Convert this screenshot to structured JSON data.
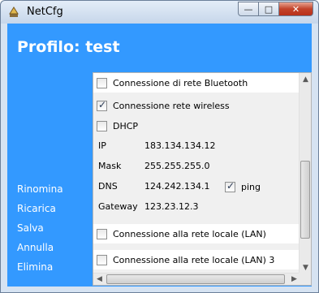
{
  "window": {
    "title": "NetCfg",
    "buttons": {
      "minimize": "—",
      "maximize": "□",
      "close": "✕"
    }
  },
  "profile": {
    "title": "Profilo: test"
  },
  "actions": [
    "Rinomina",
    "Ricarica",
    "Salva",
    "Annulla",
    "Elimina"
  ],
  "connections": {
    "bluetooth": {
      "label": "Connessione di rete Bluetooth",
      "checked": false
    },
    "wireless": {
      "label": "Connessione rete wireless",
      "checked": true,
      "dhcp": {
        "label": "DHCP",
        "checked": false
      },
      "ip": {
        "label": "IP",
        "value": "183.134.134.12"
      },
      "mask": {
        "label": "Mask",
        "value": "255.255.255.0"
      },
      "dns": {
        "label": "DNS",
        "value": "124.242.134.1"
      },
      "ping": {
        "label": "ping",
        "checked": true
      },
      "gateway": {
        "label": "Gateway",
        "value": "123.23.12.3"
      }
    },
    "lan": {
      "label": "Connessione alla rete locale (LAN)",
      "checked": false
    },
    "lan3": {
      "label": "Connessione alla rete locale (LAN) 3",
      "checked": false
    }
  },
  "scrollbars": {
    "arrows": {
      "up": "▲",
      "down": "▼",
      "left": "◀",
      "right": "▶"
    }
  },
  "colors": {
    "accent": "#3399ff",
    "panel_bg": "#f0f0f0",
    "close_button": "#c3432a"
  }
}
